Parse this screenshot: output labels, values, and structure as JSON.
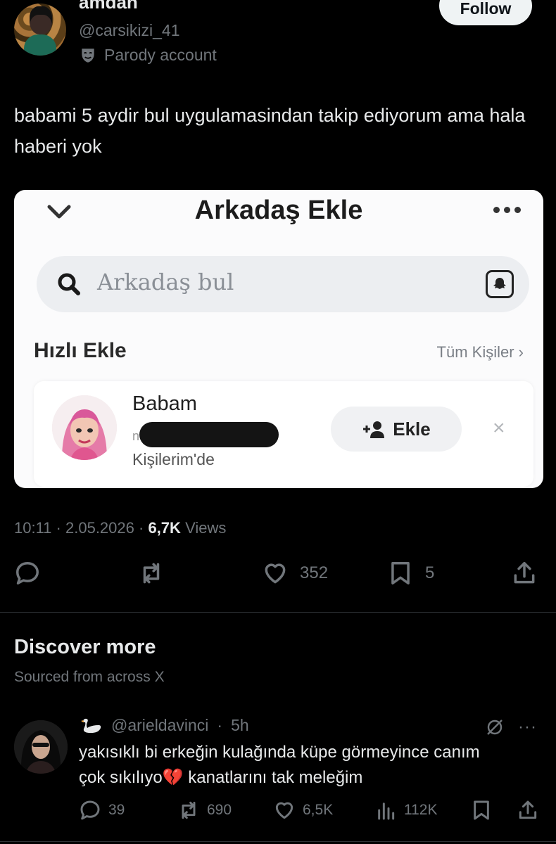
{
  "author": {
    "display_name": "amdan",
    "handle": "@carsikizi_41",
    "label": "Parody account",
    "follow_label": "Follow"
  },
  "tweet": {
    "text": "babami 5 aydir bul uygulamasindan takip ediyorum ama hala haberi yok",
    "time": "10:11",
    "date": "2.05.2026",
    "views_count": "6,7K",
    "views_label": "Views",
    "likes": "352",
    "bookmarks": "5"
  },
  "media": {
    "title": "Arkadaş Ekle",
    "search_placeholder": "Arkadaş bul",
    "quick_add_label": "Hızlı Ekle",
    "all_contacts_label": "Tüm Kişiler",
    "contact": {
      "name": "Babam",
      "sub_initial": "n",
      "location": "Kişilerim'de",
      "add_label": "Ekle",
      "dismiss": "×"
    }
  },
  "discover": {
    "title": "Discover more",
    "subtitle": "Sourced from across X"
  },
  "post2": {
    "handle": "@arieldavinci",
    "time": "5h",
    "more": "···",
    "text_line1": "yakısıklı bi erkeğin kulağında küpe görmeyince canım",
    "text_line2_a": "çok sıkılıyo",
    "text_line2_b": " kanatlarını tak meleğim",
    "replies": "39",
    "reposts": "690",
    "likes": "6,5K",
    "views": "112K"
  },
  "colors": {
    "background": "#000000",
    "text": "#e7e9ea",
    "muted": "#71767b",
    "divider": "#2f3336"
  }
}
